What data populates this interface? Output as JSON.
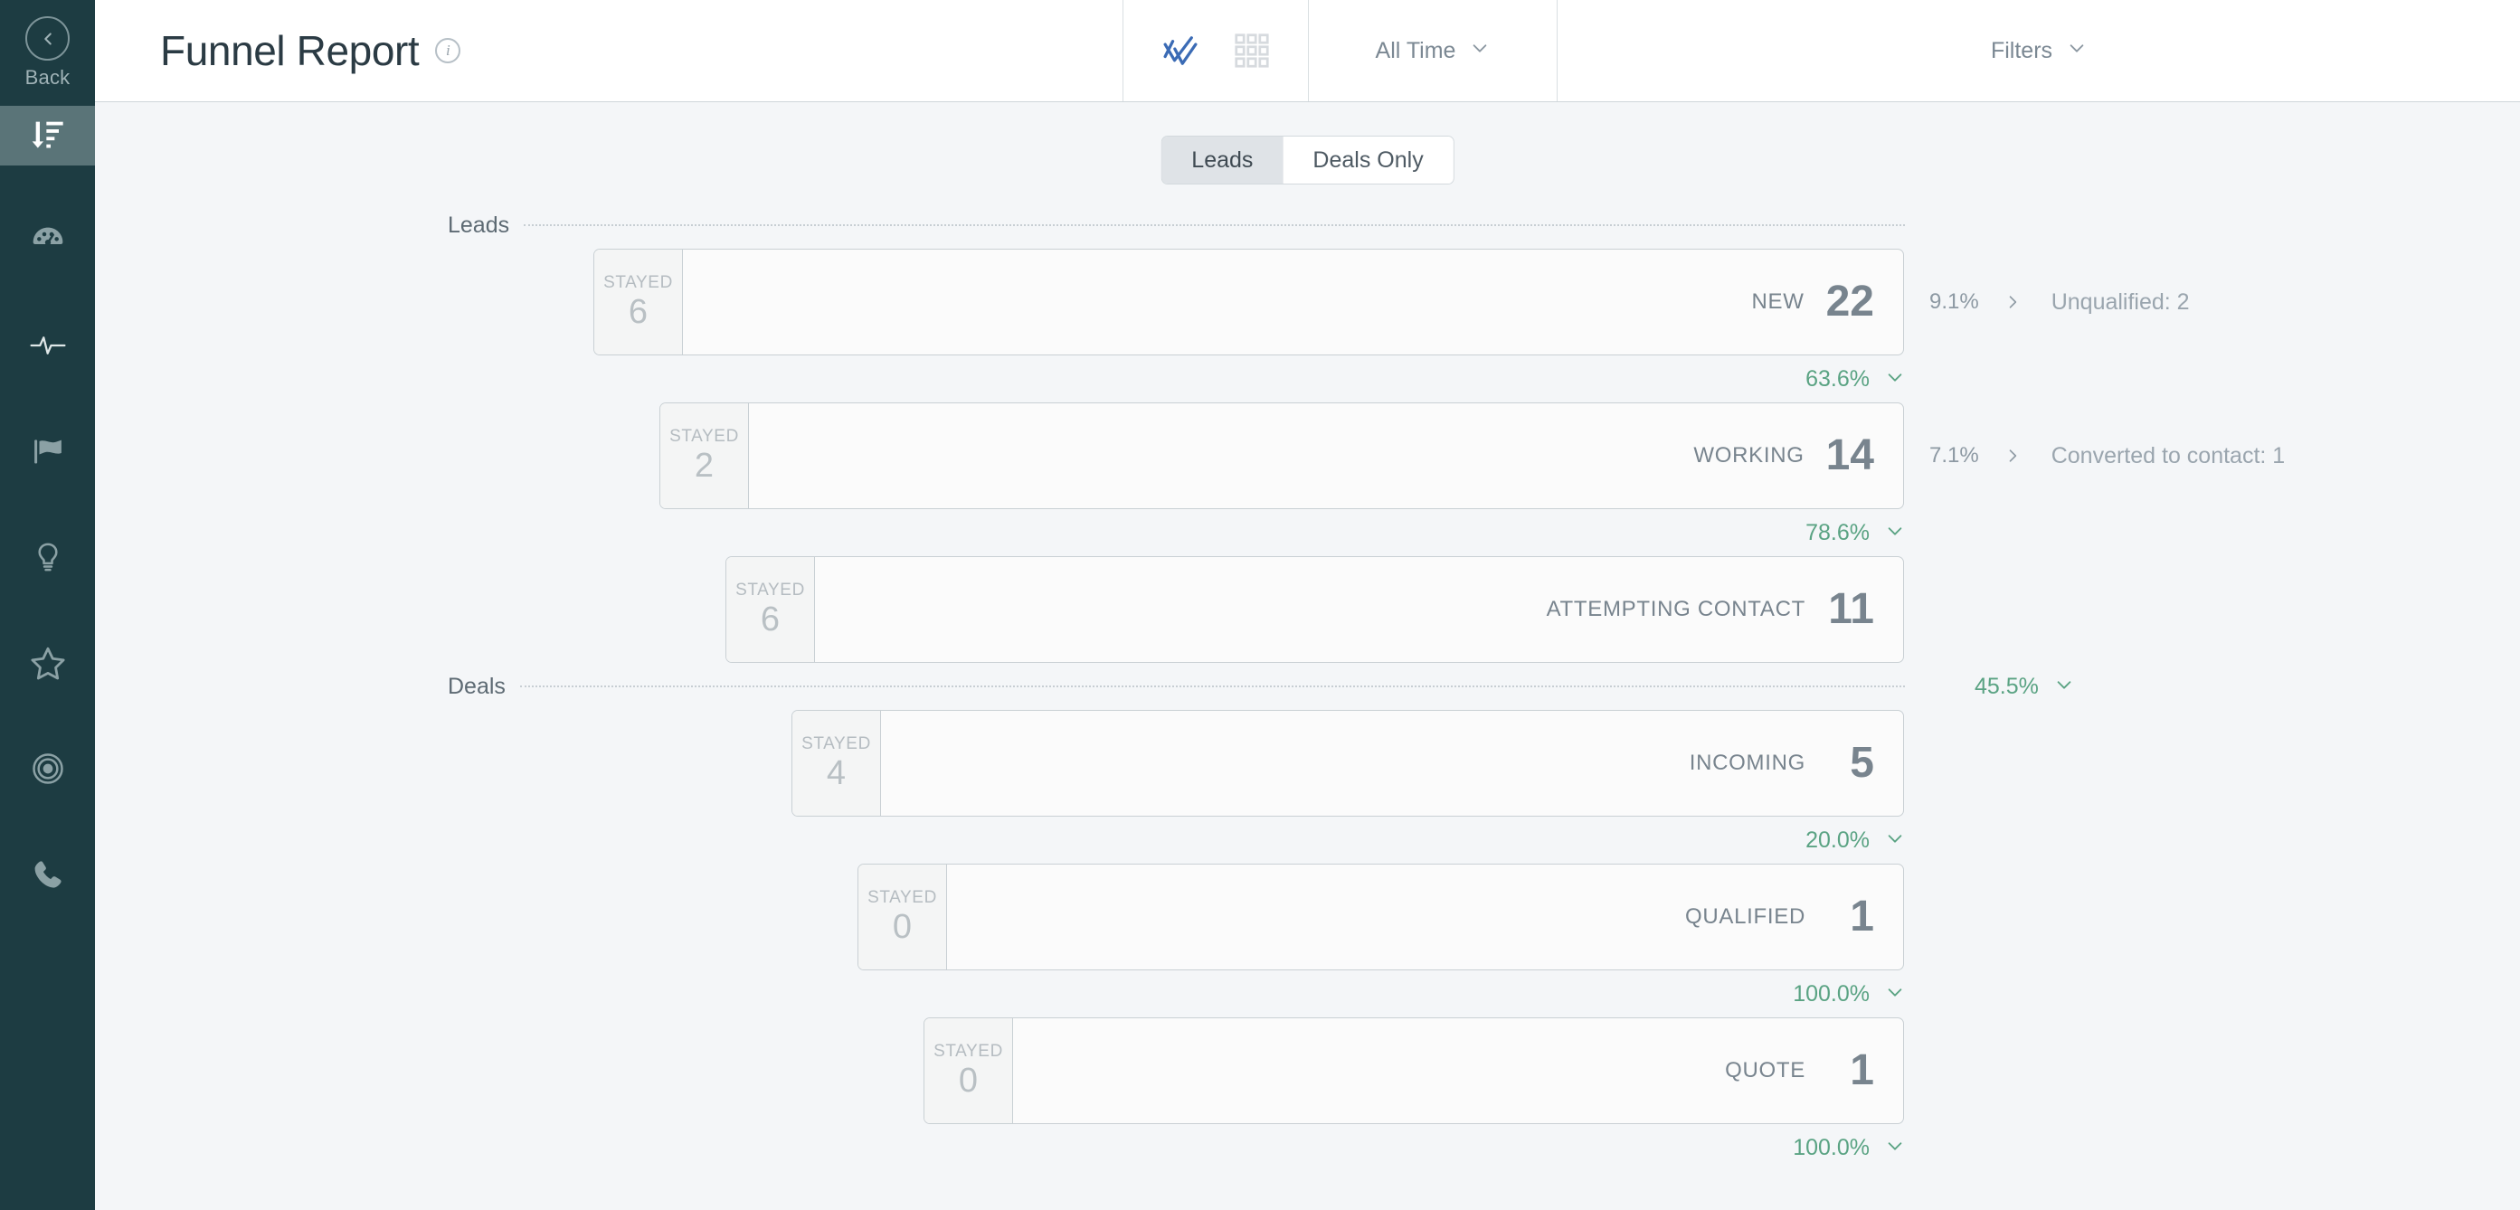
{
  "sidebar": {
    "back": {
      "label": "Back",
      "icon": "chevron-left-icon"
    },
    "items": [
      {
        "name": "funnel-report",
        "icon": "sort-descending-icon",
        "active": true
      },
      {
        "name": "dashboard",
        "icon": "gauge-icon",
        "active": false
      },
      {
        "name": "activity",
        "icon": "pulse-icon",
        "active": false
      },
      {
        "name": "goals",
        "icon": "flag-icon",
        "active": false
      },
      {
        "name": "insights",
        "icon": "lightbulb-icon",
        "active": false
      },
      {
        "name": "favorites",
        "icon": "star-icon",
        "active": false
      },
      {
        "name": "targets",
        "icon": "bullseye-icon",
        "active": false
      },
      {
        "name": "calls",
        "icon": "phone-icon",
        "active": false
      }
    ]
  },
  "header": {
    "title": "Funnel Report",
    "info_icon": "info-icon",
    "chart_toggle": {
      "icon": "chart-check-icon",
      "active": true,
      "color": "#3b6bb5"
    },
    "grid_toggle": {
      "icon": "grid-icon",
      "active": false
    },
    "date_filter": {
      "label": "All Time",
      "icon": "chevron-down-icon"
    },
    "filters": {
      "label": "Filters",
      "icon": "chevron-down-icon"
    }
  },
  "tabs": [
    {
      "label": "Leads",
      "active": true
    },
    {
      "label": "Deals Only",
      "active": false
    }
  ],
  "colors": {
    "conversion_green": "#5aa383",
    "stage_text": "#78848e",
    "sidebar_bg": "#1d3c42",
    "sidebar_active": "#5a7478"
  },
  "chart_data": {
    "type": "funnel",
    "title": "Funnel Report",
    "stayed_label": "STAYED",
    "sections": [
      {
        "label": "Leads",
        "conversion_to_next": null
      },
      {
        "label": "Deals",
        "conversion_to_next": "45.5%"
      }
    ],
    "stages": [
      {
        "label": "NEW",
        "count": 22,
        "stayed": 6,
        "indent": 0,
        "section": "Leads",
        "conversion_below": "63.6%",
        "side_note": {
          "pct": "9.1%",
          "text": "Unqualified: 2"
        }
      },
      {
        "label": "WORKING",
        "count": 14,
        "stayed": 2,
        "indent": 1,
        "section": "Leads",
        "conversion_below": "78.6%",
        "side_note": {
          "pct": "7.1%",
          "text": "Converted to contact: 1"
        }
      },
      {
        "label": "ATTEMPTING CONTACT",
        "count": 11,
        "stayed": 6,
        "indent": 2,
        "section": "Leads",
        "conversion_below": "45.5%",
        "side_note": null
      },
      {
        "label": "INCOMING",
        "count": 5,
        "stayed": 4,
        "indent": 3,
        "section": "Deals",
        "conversion_below": "20.0%",
        "side_note": null
      },
      {
        "label": "QUALIFIED",
        "count": 1,
        "stayed": 0,
        "indent": 4,
        "section": "Deals",
        "conversion_below": "100.0%",
        "side_note": null
      },
      {
        "label": "QUOTE",
        "count": 1,
        "stayed": 0,
        "indent": 5,
        "section": "Deals",
        "conversion_below": "100.0%",
        "side_note": null
      }
    ]
  }
}
